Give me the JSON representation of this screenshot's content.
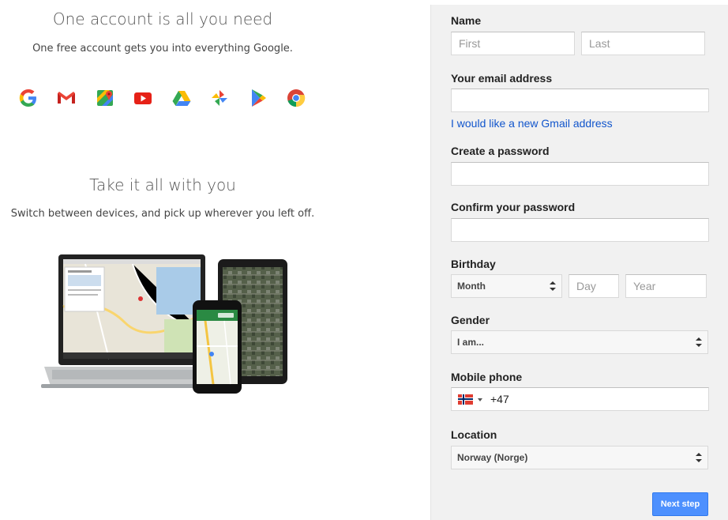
{
  "promo": {
    "heading1": "One account is all you need",
    "sub1": "One free account gets you into everything Google.",
    "heading2": "Take it all with you",
    "sub2": "Switch between devices, and pick up wherever you left off.",
    "product_icons": [
      "google-g-icon",
      "gmail-icon",
      "maps-icon",
      "youtube-icon",
      "drive-icon",
      "photos-icon",
      "play-icon",
      "chrome-icon"
    ]
  },
  "form": {
    "name_label": "Name",
    "first_placeholder": "First",
    "last_placeholder": "Last",
    "email_label": "Your email address",
    "email_value": "",
    "gmail_link": "I would like a new Gmail address",
    "password_label": "Create a password",
    "confirm_label": "Confirm your password",
    "birthday_label": "Birthday",
    "month_value": "Month",
    "day_placeholder": "Day",
    "year_placeholder": "Year",
    "gender_label": "Gender",
    "gender_value": "I am...",
    "phone_label": "Mobile phone",
    "phone_code": "+47",
    "phone_flag": "norway-flag-icon",
    "location_label": "Location",
    "location_value": "Norway (Norge)",
    "next_button": "Next step"
  },
  "colors": {
    "panel_bg": "#f1f1f1",
    "link": "#1155cc",
    "button": "#4d90fe"
  }
}
